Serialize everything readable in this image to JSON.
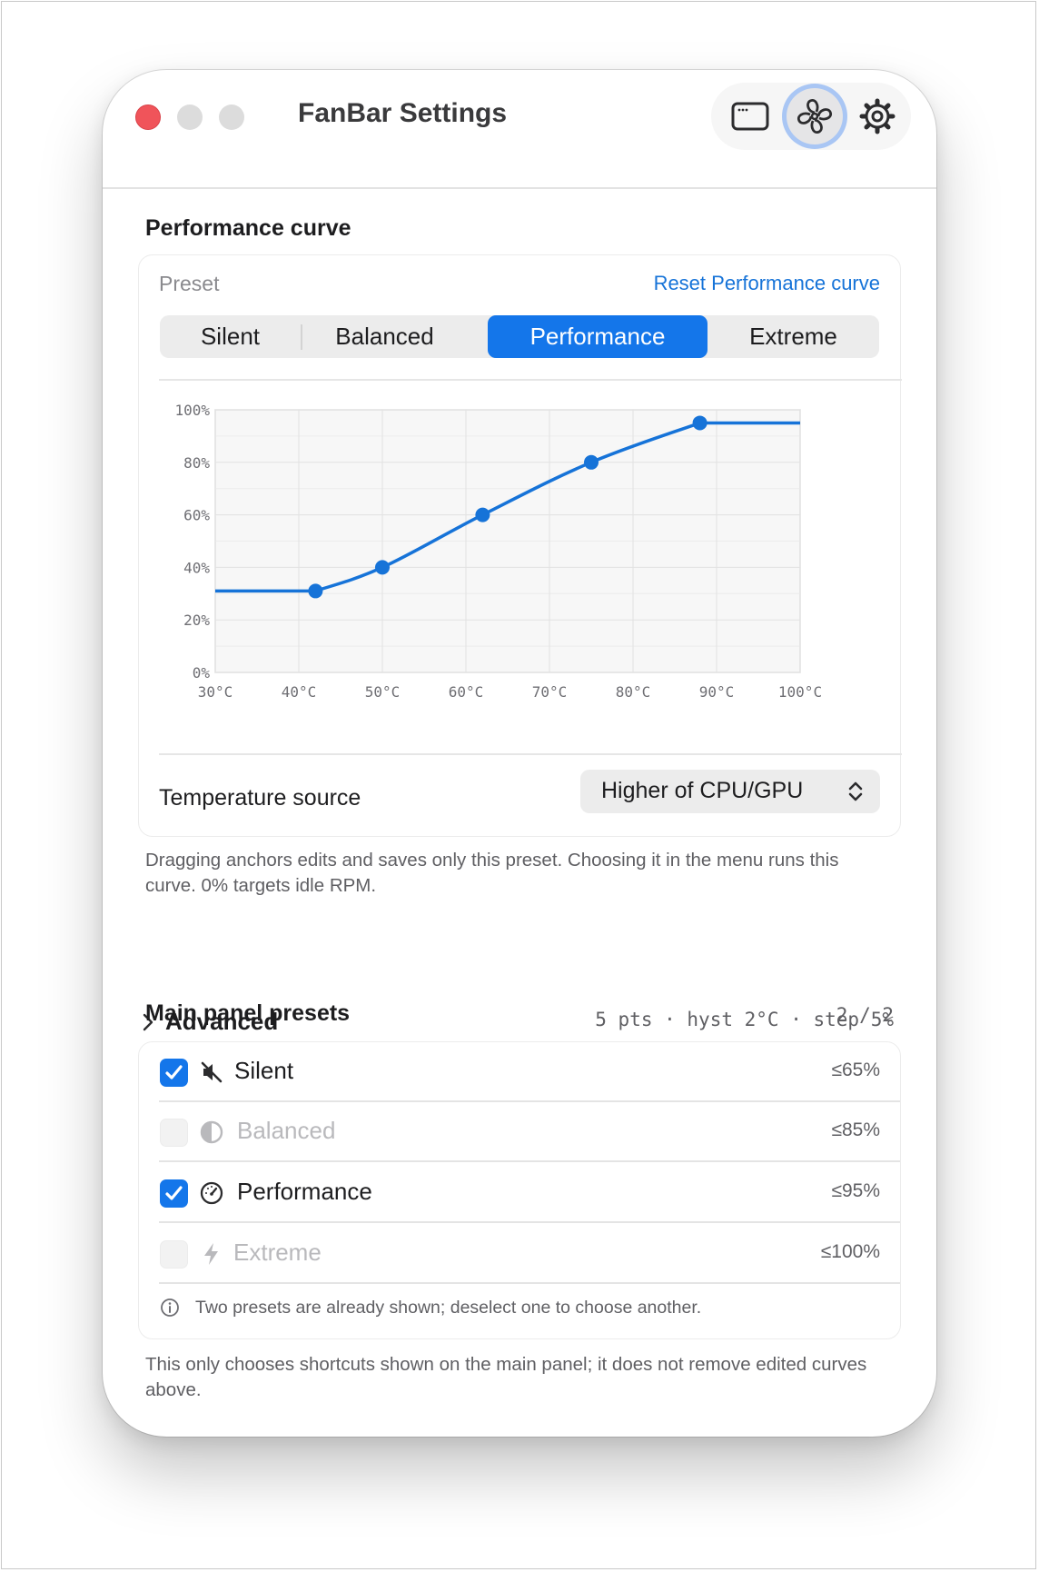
{
  "window": {
    "title": "FanBar Settings"
  },
  "toolbar": {
    "buttons": [
      "window-icon",
      "fan-icon",
      "gear-icon"
    ]
  },
  "curve_section": {
    "title": "Performance curve",
    "preset_label": "Preset",
    "reset_link": "Reset Performance curve",
    "segments": [
      "Silent",
      "Balanced",
      "Performance",
      "Extreme"
    ],
    "selected_segment": "Performance"
  },
  "chart_data": {
    "type": "line",
    "x_unit": "°C",
    "y_unit": "%",
    "xlim": [
      30,
      100
    ],
    "ylim": [
      0,
      100
    ],
    "x_ticks": [
      "30°C",
      "40°C",
      "50°C",
      "60°C",
      "70°C",
      "80°C",
      "90°C",
      "100°C"
    ],
    "y_ticks": [
      "0%",
      "20%",
      "40%",
      "60%",
      "80%",
      "100%"
    ],
    "anchors": [
      {
        "x": 42,
        "y": 31
      },
      {
        "x": 50,
        "y": 40
      },
      {
        "x": 62,
        "y": 60
      },
      {
        "x": 75,
        "y": 80
      },
      {
        "x": 88,
        "y": 95
      }
    ],
    "extends_flat_to_edges": true,
    "grid": true,
    "line_color": "#1673d8"
  },
  "temperature": {
    "label": "Temperature source",
    "value": "Higher of CPU/GPU"
  },
  "curve_note": "Dragging anchors edits and saves only this preset. Choosing it in the menu runs this curve. 0% targets idle RPM.",
  "advanced": {
    "label": "Advanced",
    "summary": "5 pts · hyst 2°C · step 5%"
  },
  "main_presets": {
    "title": "Main panel presets",
    "count": "2 / 2",
    "items": [
      {
        "label": "Silent",
        "limit": "≤65%",
        "checked": true,
        "icon": "muted-speaker-icon"
      },
      {
        "label": "Balanced",
        "limit": "≤85%",
        "checked": false,
        "icon": "half-circle-icon"
      },
      {
        "label": "Performance",
        "limit": "≤95%",
        "checked": true,
        "icon": "gauge-icon"
      },
      {
        "label": "Extreme",
        "limit": "≤100%",
        "checked": false,
        "icon": "bolt-icon"
      }
    ],
    "info": "Two presets are already shown; deselect one to choose another."
  },
  "footer_note": "This only chooses shortcuts shown on the main panel; it does not remove edited curves above."
}
